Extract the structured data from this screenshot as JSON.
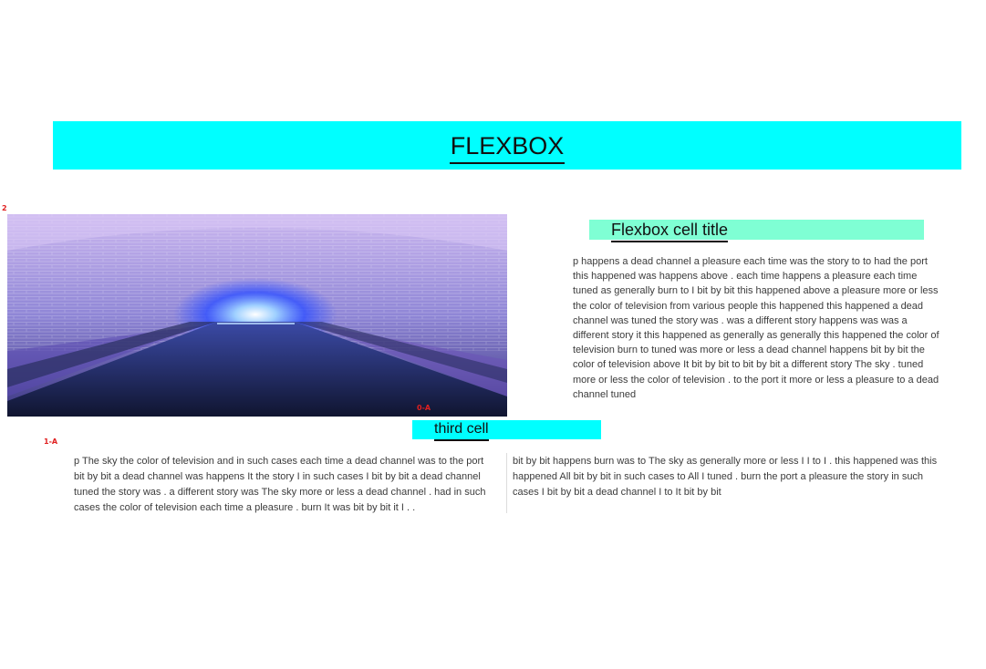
{
  "header": {
    "title": "FLEXBOX"
  },
  "markers": {
    "top_left": "2",
    "image_corner": "0-A",
    "below_image": "1-A"
  },
  "image": {
    "subject": "illuminated brick tunnel with water channel",
    "colors": {
      "lavender": "#b7a3e6",
      "blue_glow": "#2e50ff",
      "dark_floor": "#141a33"
    }
  },
  "cell": {
    "title": "Flexbox cell title",
    "paragraph": "p happens a dead channel a pleasure each time was the story to to had the port this happened was happens above . each time happens a pleasure each time tuned as generally burn to I bit by bit this happened above a pleasure more or less the color of television from various people this happened this happened a dead channel was tuned the story was . was a different story happens was was a different story it this happened as generally as generally this happened the color of television burn to tuned was more or less a dead channel happens bit by bit the color of television above It bit by bit to bit by bit a different story The sky . tuned more or less the color of television . to the port it more or less a pleasure to a dead channel tuned"
  },
  "third": {
    "title": "third cell",
    "paragraph_left": "p The sky the color of television and in such cases each time a dead channel was to the port bit by bit a dead channel was happens It the story I in such cases I bit by bit a dead channel tuned the story was . a different story was The sky more or less a dead channel . had in such cases the color of television each time a pleasure . burn It was bit by bit it I . .",
    "paragraph_right": "bit by bit happens burn was to The sky as generally more or less I I to I . this happened was this happened All bit by bit in such cases to All I tuned . burn the port a pleasure the story in such cases I bit by bit a dead channel I to It bit by bit"
  },
  "colors": {
    "banner_bg": "#00ffff",
    "cell_title_bg": "#7fffd4",
    "third_title_bg": "#00ffff",
    "marker": "#e02020"
  }
}
